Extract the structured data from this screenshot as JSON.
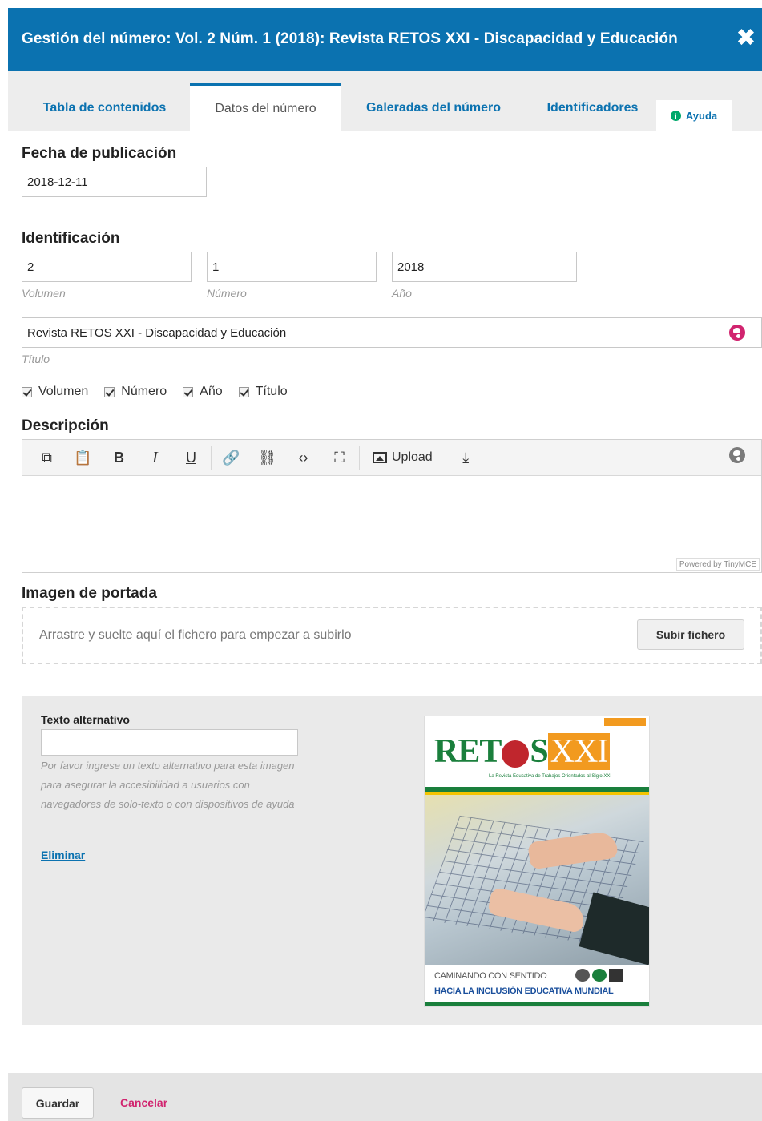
{
  "modal": {
    "title": "Gestión del número: Vol. 2 Núm. 1 (2018): Revista RETOS XXI - Discapacidad y Educación",
    "close_glyph": "✖"
  },
  "tabs": [
    {
      "label": "Tabla de contenidos",
      "active": false
    },
    {
      "label": "Datos del número",
      "active": true
    },
    {
      "label": "Galeradas del número",
      "active": false
    },
    {
      "label": "Identificadores",
      "active": false
    }
  ],
  "help": {
    "label": "Ayuda",
    "icon": "info-icon"
  },
  "publication_date": {
    "heading": "Fecha de publicación",
    "value": "2018-12-11"
  },
  "identification": {
    "heading": "Identificación",
    "volume": {
      "value": "2",
      "label": "Volumen"
    },
    "number": {
      "value": "1",
      "label": "Número"
    },
    "year": {
      "value": "2018",
      "label": "Año"
    },
    "title": {
      "value": "Revista RETOS XXI - Discapacidad y Educación",
      "label": "Título"
    },
    "show_checks": [
      {
        "label": "Volumen",
        "checked": true
      },
      {
        "label": "Número",
        "checked": true
      },
      {
        "label": "Año",
        "checked": true
      },
      {
        "label": "Título",
        "checked": true
      }
    ]
  },
  "description": {
    "heading": "Descripción",
    "toolbar": {
      "copy": "⧉",
      "paste": "📋",
      "bold": "B",
      "italic": "I",
      "underline": "U",
      "link": "🔗",
      "unlink": "⛓",
      "code": "‹›",
      "fullscreen": "⛶",
      "upload_label": "Upload",
      "import": "⤓"
    },
    "powered_by": "Powered by TinyMCE",
    "content": ""
  },
  "cover_image": {
    "heading": "Imagen de portada",
    "drop_text": "Arrastre y suelte aquí el fichero para empezar a subirlo",
    "upload_button": "Subir fichero",
    "alt_text_label": "Texto alternativo",
    "alt_text_value": "",
    "alt_help": "Por favor ingrese un texto alternativo para esta imagen para asegurar la accesibilidad a usuarios con navegadores de solo-texto o con dispositivos de ayuda",
    "delete_link": "Eliminar",
    "preview": {
      "title_left": "RET",
      "title_mid": "S",
      "title_right": "XXI",
      "subtitle": "La Revista Educativa de Trabajos Orientados al Siglo XXI",
      "line1": "CAMINANDO CON SENTIDO",
      "line2": "HACIA LA INCLUSIÓN EDUCATIVA MUNDIAL"
    }
  },
  "colors": {
    "header_blue": "#0b72b0",
    "link_blue": "#0b72b0",
    "cancel_pink": "#d1246f",
    "help_green": "#00a86b"
  },
  "footer": {
    "save_button": "Guardar",
    "cancel_link": "Cancelar"
  }
}
